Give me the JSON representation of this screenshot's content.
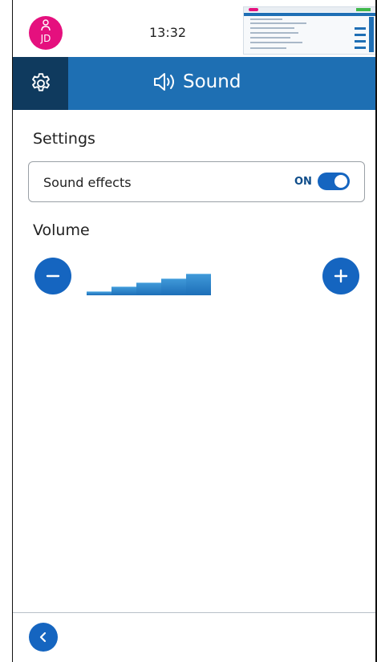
{
  "status_bar": {
    "avatar_initials": "JD",
    "time": "13:32",
    "avatar_color": "#e5107e"
  },
  "header": {
    "settings_icon": "gear-icon",
    "title_icon": "speaker-icon",
    "title": "Sound",
    "color": "#1e6fb3",
    "settings_bg": "#0f3a5e"
  },
  "settings_section": {
    "title": "Settings",
    "sound_effects": {
      "label": "Sound effects",
      "state_text": "ON",
      "enabled": true
    }
  },
  "volume_section": {
    "title": "Volume",
    "decrease_icon": "minus-icon",
    "increase_icon": "plus-icon",
    "level": 5,
    "max_level": 5
  },
  "footer": {
    "back_icon": "chevron-left-icon"
  },
  "colors": {
    "accent": "#1565c0"
  }
}
